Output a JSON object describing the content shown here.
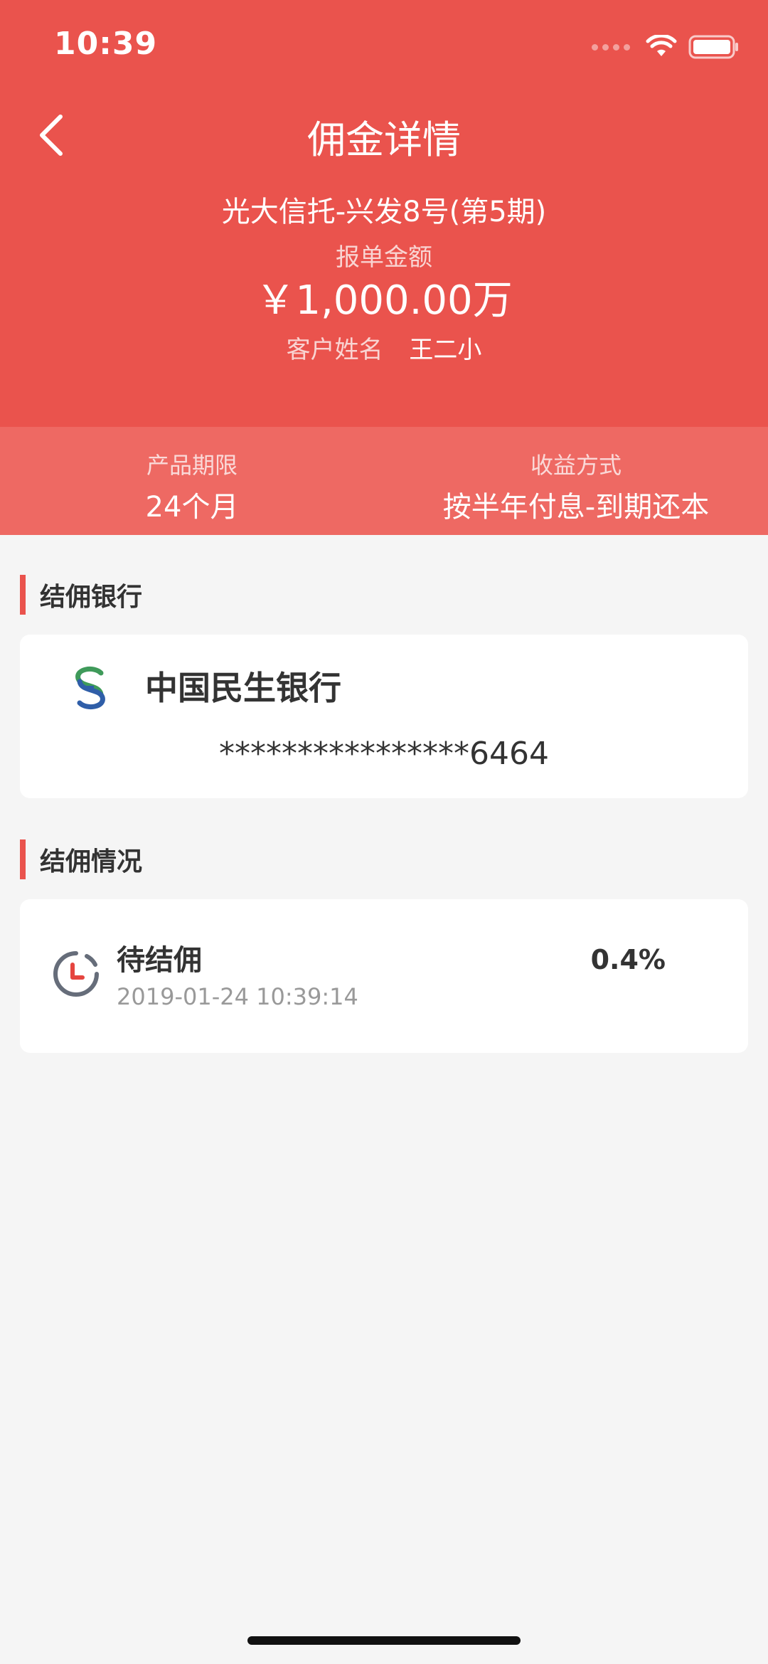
{
  "status_bar": {
    "time": "10:39"
  },
  "nav": {
    "title": "佣金详情",
    "back_icon": "chevron-left-icon"
  },
  "order": {
    "product_name": "光大信托-兴发8号(第5期)",
    "amount_label": "报单金额",
    "amount_value": "￥1,000.00万",
    "customer_label": "客户姓名",
    "customer_name": "王二小"
  },
  "stats": {
    "term_label": "产品期限",
    "term_value": "24个月",
    "income_label": "收益方式",
    "income_value": "按半年付息-到期还本"
  },
  "bank_section": {
    "title": "结佣银行",
    "bank_name": "中国民生银行",
    "account": "****************6464"
  },
  "commission_section": {
    "title": "结佣情况",
    "status": "待结佣",
    "date": "2019-01-24 10:39:14",
    "rate": "0.4%"
  },
  "colors": {
    "primary": "#ea534d",
    "stats_bg": "#ee6963",
    "page_bg": "#f5f5f5"
  }
}
